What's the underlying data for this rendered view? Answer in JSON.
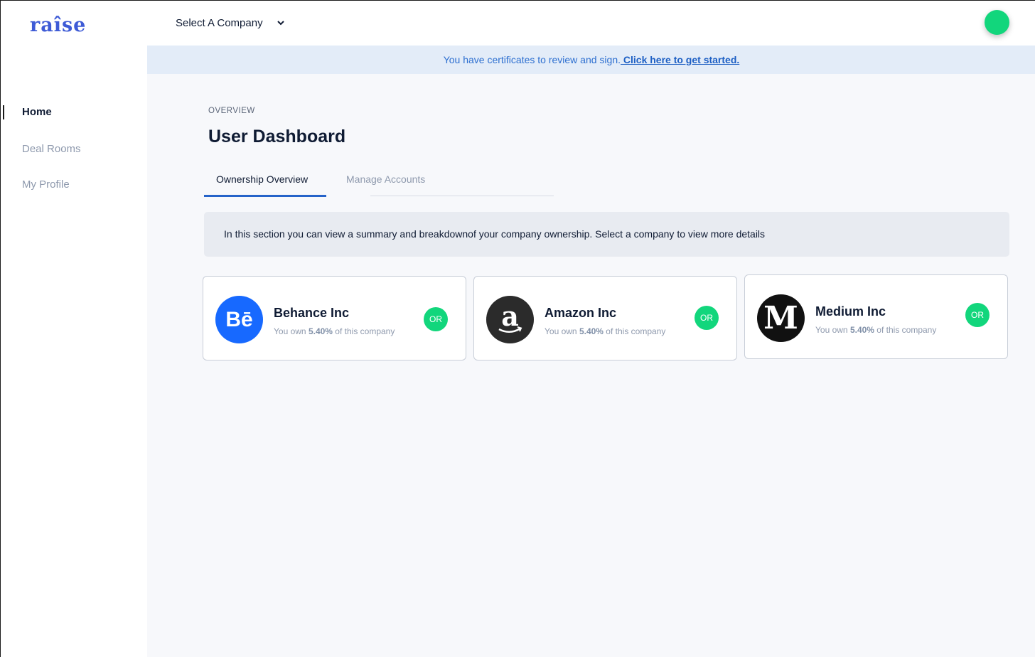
{
  "brand": {
    "name": "raîse",
    "color": "#3e5bd6"
  },
  "header": {
    "company_select_label": "Select A Company",
    "chevron_icon": "chevron-down-icon"
  },
  "sidebar": {
    "items": [
      {
        "label": "Home",
        "active": true
      },
      {
        "label": "Deal Rooms",
        "active": false
      },
      {
        "label": "My Profile",
        "active": false
      }
    ]
  },
  "banner": {
    "text": "You have certificates to review and sign.",
    "link": " Click here to get started."
  },
  "main": {
    "overline": "OVERVIEW",
    "title": "User Dashboard",
    "tabs": [
      {
        "label": "Ownership Overview",
        "active": true
      },
      {
        "label": "Manage Accounts",
        "active": false
      }
    ],
    "info": "In this section you can view a summary  and breakdownof your company ownership. Select a company to view more details"
  },
  "companies": [
    {
      "name": "Behance Inc",
      "prefix": "You own ",
      "percent": "5.40%",
      "suffix": " of this company",
      "badge": "OR",
      "logo_glyph": "Bē",
      "logo_icon": "behance-logo-icon",
      "logo_color": "#1769ff"
    },
    {
      "name": "Amazon Inc",
      "prefix": "You own ",
      "percent": "5.40%",
      "suffix": " of this company",
      "badge": "OR",
      "logo_glyph": "a",
      "logo_icon": "amazon-logo-icon",
      "logo_color": "#2b2b2b"
    },
    {
      "name": "Medium Inc",
      "prefix": "You own ",
      "percent": "5.40%",
      "suffix": " of this company",
      "badge": "OR",
      "logo_glyph": "M",
      "logo_icon": "medium-logo-icon",
      "logo_color": "#111111"
    }
  ],
  "colors": {
    "accent": "#2563c9",
    "badge": "#12d67c",
    "banner_bg": "#e3ecf8"
  }
}
